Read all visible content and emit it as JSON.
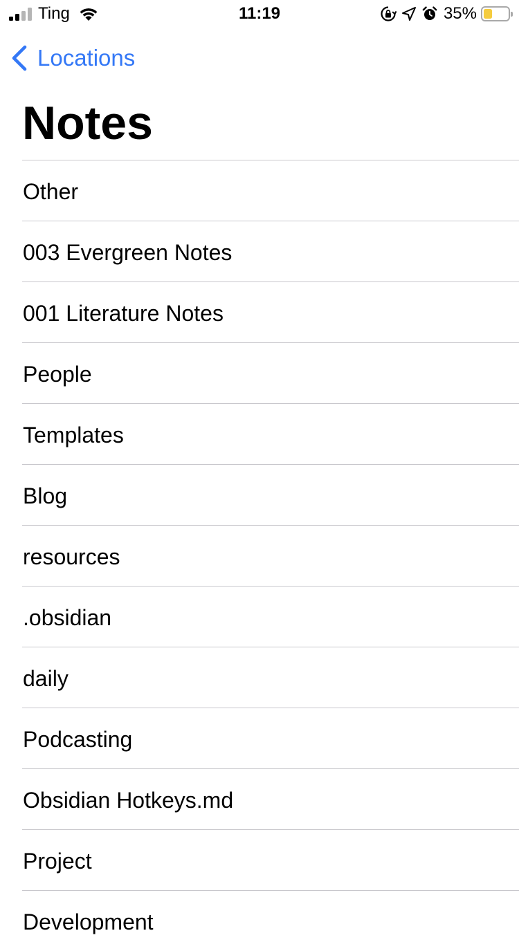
{
  "status_bar": {
    "carrier": "Ting",
    "time": "11:19",
    "battery_percent": "35%",
    "battery_level": 0.35,
    "signal_bars_active": 2,
    "signal_bars_total": 4,
    "icons": [
      "signal-icon",
      "wifi-icon",
      "orientation-lock-icon",
      "location-arrow-icon",
      "alarm-icon",
      "battery-icon"
    ]
  },
  "navigation": {
    "back_label": "Locations",
    "back_icon": "chevron-left-icon",
    "title": "Notes"
  },
  "list": {
    "items": [
      {
        "label": "Other"
      },
      {
        "label": "003 Evergreen Notes"
      },
      {
        "label": "001 Literature Notes"
      },
      {
        "label": "People"
      },
      {
        "label": "Templates"
      },
      {
        "label": "Blog"
      },
      {
        "label": "resources"
      },
      {
        "label": ".obsidian"
      },
      {
        "label": "daily"
      },
      {
        "label": "Podcasting"
      },
      {
        "label": "Obsidian Hotkeys.md"
      },
      {
        "label": "Project"
      },
      {
        "label": "Development"
      }
    ]
  },
  "colors": {
    "accent": "#3478f6",
    "separator": "#c8c7cc",
    "battery_fill": "#f5cc3e",
    "signal_active": "#000000",
    "signal_inactive": "#b5b5b5"
  }
}
